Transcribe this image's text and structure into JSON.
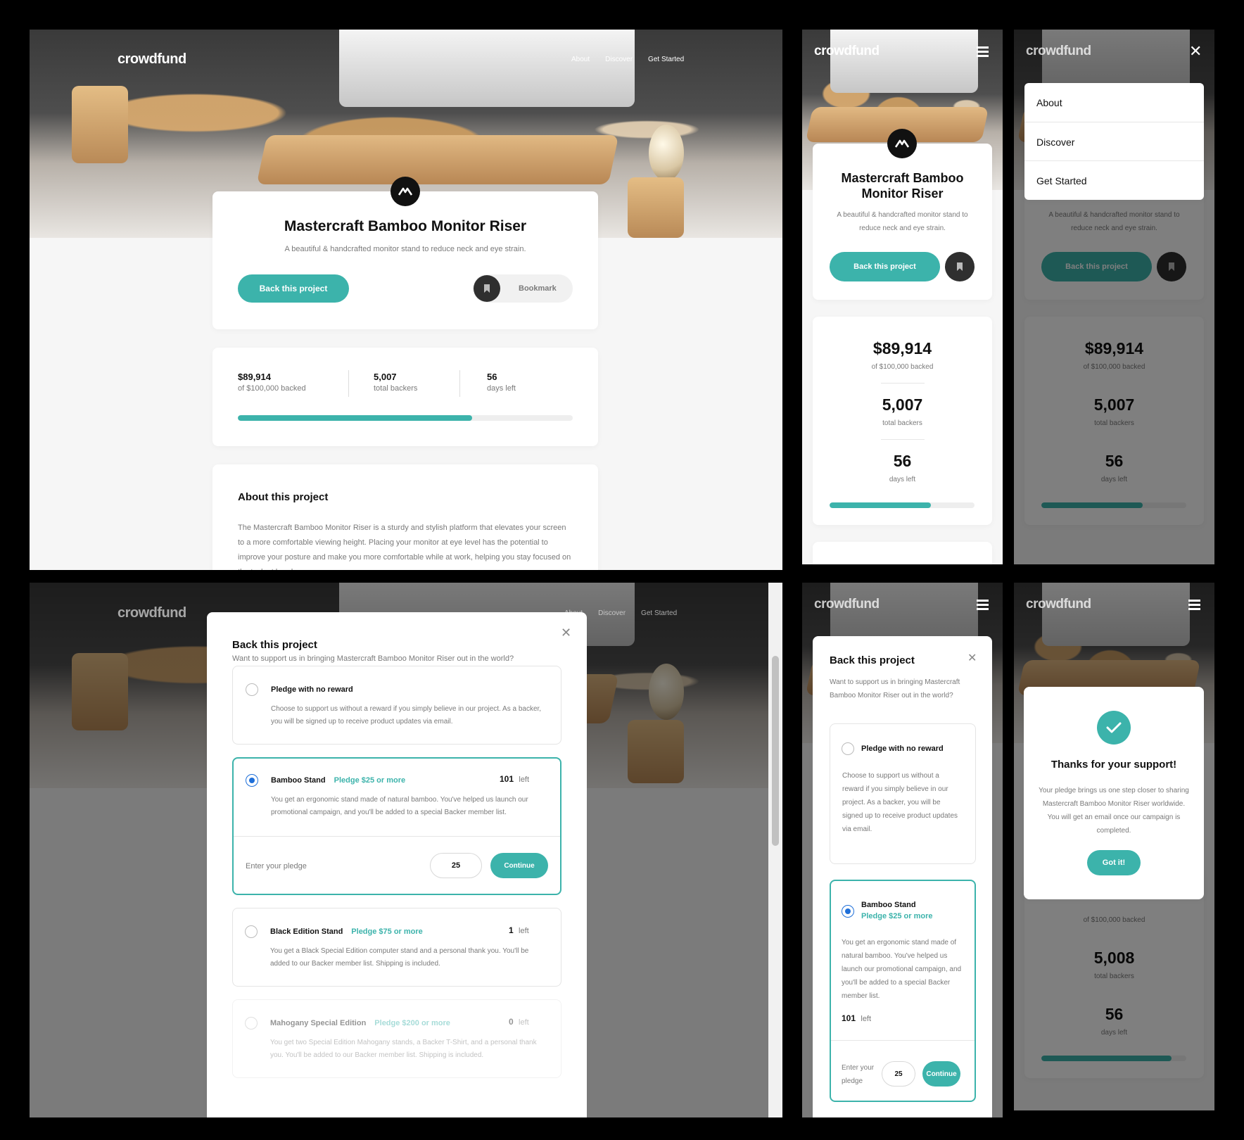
{
  "brand": {
    "logo_text": "crowdfund",
    "accent_color": "#3cb3ab",
    "dark_color": "#2f2f2f"
  },
  "nav": {
    "items": [
      "About",
      "Discover",
      "Get Started"
    ]
  },
  "project": {
    "title": "Mastercraft Bamboo Monitor Riser",
    "description": "A beautiful & handcrafted monitor stand to reduce neck and eye strain.",
    "back_label": "Back this project",
    "bookmark_label": "Bookmark"
  },
  "stats": {
    "backed_amount": "$89,914",
    "backed_label": "of $100,000 backed",
    "backers": "5,007",
    "backers_label": "total backers",
    "backers_after": "5,008",
    "days": "56",
    "days_label": "days left",
    "progress": 0.89914
  },
  "about": {
    "heading": "About this project",
    "text": "The Mastercraft Bamboo Monitor Riser is a sturdy and stylish platform that elevates your screen to a more comfortable viewing height. Placing your monitor at eye level has the potential to improve your posture and make you more comfortable while at work, helping you stay focused on the task at hand."
  },
  "modal": {
    "title": "Back this project",
    "subtitle": "Want to support us in bringing Mastercraft Bamboo Monitor Riser out in the world?",
    "enter_pledge": "Enter your pledge",
    "pledge_value": "25",
    "continue_label": "Continue",
    "left_word": "left",
    "options": [
      {
        "name": "Pledge with no reward",
        "price": "",
        "left": "",
        "description": "Choose to support us without a reward if you simply believe in our project. As a backer, you will be signed up to receive product updates via email."
      },
      {
        "name": "Bamboo Stand",
        "price": "Pledge $25 or more",
        "left": "101",
        "description": "You get an ergonomic stand made of natural bamboo. You've helped us launch our promotional campaign, and you'll be added to a special Backer member list."
      },
      {
        "name": "Black Edition Stand",
        "price": "Pledge $75 or more",
        "left": "1",
        "description": "You get a Black Special Edition computer stand and a personal thank you. You'll be added to our Backer member list. Shipping is included."
      },
      {
        "name": "Mahogany Special Edition",
        "price": "Pledge $200 or more",
        "left": "0",
        "description": "You get two Special Edition Mahogany stands, a Backer T-Shirt, and a personal thank you. You'll be added to our Backer member list. Shipping is included."
      }
    ]
  },
  "success": {
    "title": "Thanks for your support!",
    "text": "Your pledge brings us one step closer to sharing Mastercraft Bamboo Monitor Riser worldwide. You will get an email once our campaign is completed.",
    "button": "Got it!"
  },
  "icons": [
    "hamburger-icon",
    "close-icon",
    "bookmark-icon",
    "check-icon",
    "mastercraft-logo-icon"
  ]
}
